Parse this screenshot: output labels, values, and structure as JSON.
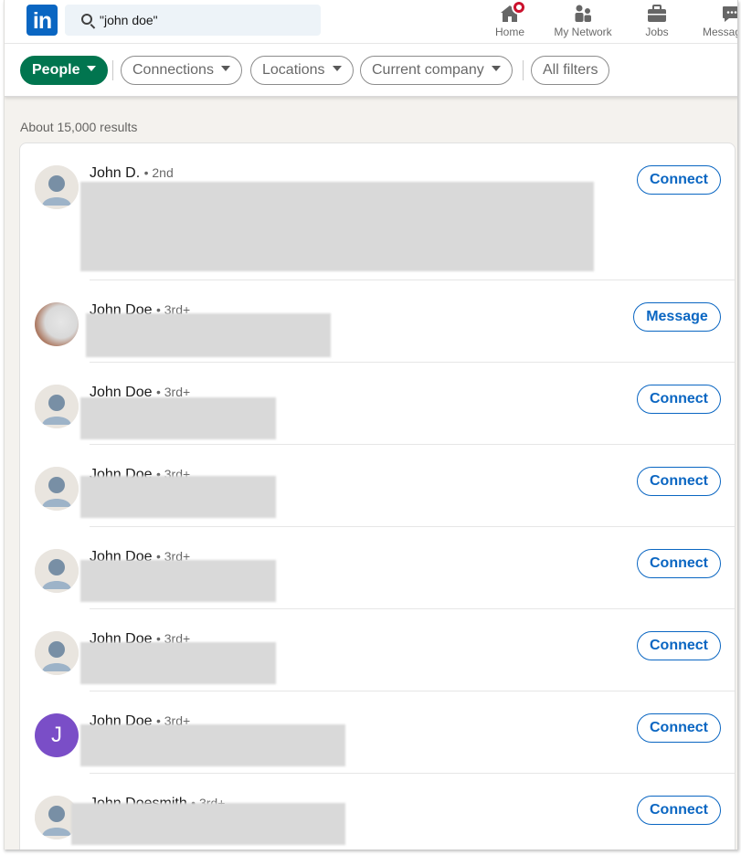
{
  "app": {
    "logo_text": "in",
    "brand_color": "#0a66c2"
  },
  "search": {
    "value": "\"john doe\""
  },
  "nav": {
    "items": [
      {
        "label": "Home",
        "icon": "home-icon",
        "badge": true
      },
      {
        "label": "My Network",
        "icon": "network-icon"
      },
      {
        "label": "Jobs",
        "icon": "jobs-icon"
      },
      {
        "label": "Messag",
        "icon": "messaging-icon"
      }
    ]
  },
  "filters": {
    "people": "People",
    "connections": "Connections",
    "locations": "Locations",
    "current_company": "Current company",
    "all_filters": "All filters",
    "active_color": "#01754f"
  },
  "results": {
    "count_text": "About 15,000 results",
    "items": [
      {
        "name": "John D.",
        "degree": "• 2nd",
        "action": "Connect",
        "avatar": "default"
      },
      {
        "name": "John Doe",
        "degree": "• 3rd+",
        "action": "Message",
        "avatar": "photo"
      },
      {
        "name": "John Doe",
        "degree": "• 3rd+",
        "action": "Connect",
        "avatar": "default"
      },
      {
        "name": "John Doe",
        "degree": "• 3rd+",
        "action": "Connect",
        "avatar": "default"
      },
      {
        "name": "John Doe",
        "degree": "• 3rd+",
        "action": "Connect",
        "avatar": "default"
      },
      {
        "name": "John Doe",
        "degree": "• 3rd+",
        "action": "Connect",
        "avatar": "default"
      },
      {
        "name": "John Doe",
        "degree": "• 3rd+",
        "action": "Connect",
        "avatar": "letter",
        "avatar_letter": "J",
        "avatar_color": "#7a4ec7"
      },
      {
        "name": "John Doesmith",
        "degree": "• 3rd+",
        "action": "Connect",
        "avatar": "default"
      }
    ]
  }
}
